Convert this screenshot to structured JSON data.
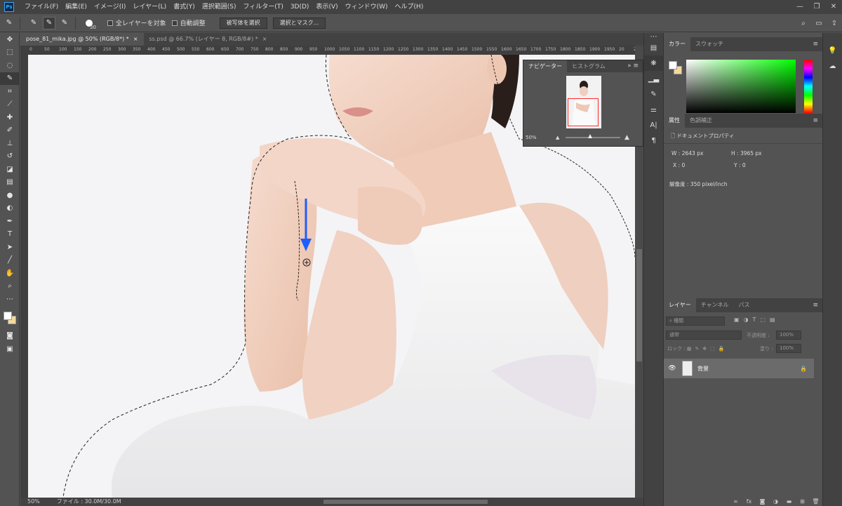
{
  "menubar": {
    "logo": "Ps",
    "items": [
      "ファイル(F)",
      "編集(E)",
      "イメージ(I)",
      "レイヤー(L)",
      "書式(Y)",
      "選択範囲(S)",
      "フィルター(T)",
      "3D(D)",
      "表示(V)",
      "ウィンドウ(W)",
      "ヘルプ(H)"
    ]
  },
  "options": {
    "brush_size": "30",
    "sample_all": "全レイヤーを対象",
    "auto_enhance": "自動調整",
    "select_subject": "被写体を選択",
    "select_mask": "選択とマスク..."
  },
  "tabs": [
    {
      "label": "pose_81_mika.jpg @ 50% (RGB/8*) *",
      "close": "×"
    },
    {
      "label": "ss.psd @ 66.7% (レイヤー 8, RGB/8#) *",
      "close": "×"
    }
  ],
  "ruler": {
    "top_ticks": [
      "0",
      "50",
      "100",
      "150",
      "200",
      "250",
      "300",
      "350",
      "400",
      "450",
      "500",
      "550",
      "600",
      "650",
      "700",
      "750",
      "800",
      "850",
      "900",
      "950",
      "1000",
      "1050",
      "1100",
      "1150",
      "1200",
      "1250",
      "1300",
      "1350",
      "1400",
      "1450",
      "1500",
      "1550",
      "1600",
      "1650",
      "1700",
      "1750",
      "1800",
      "1850",
      "1900",
      "1950",
      "20",
      "25"
    ]
  },
  "status": {
    "zoom": "50%",
    "file": "ファイル : 30.0M/30.0M"
  },
  "navigator": {
    "tabs": [
      "ナビゲーター",
      "ヒストグラム"
    ],
    "zoom": "50%"
  },
  "color_panel": {
    "tabs": [
      "カラー",
      "スウォッチ"
    ],
    "fg": "#ffffff",
    "bg": "#f5d99c"
  },
  "properties": {
    "tabs": [
      "属性",
      "色調補正"
    ],
    "section": "ドキュメントプロパティ",
    "w_label": "W :",
    "w_value": "2643 px",
    "h_label": "H :",
    "h_value": "3965 px",
    "x_label": "X :",
    "x_value": "0",
    "y_label": "Y :",
    "y_value": "0",
    "resolution": "解像度 : 350 pixel/inch"
  },
  "layers": {
    "tabs": [
      "レイヤー",
      "チャンネル",
      "パス"
    ],
    "filter_placeholder": "種類",
    "blend_mode": "通常",
    "opacity_label": "不透明度 :",
    "opacity_value": "100%",
    "lock_label": "ロック :",
    "fill_label": "塗り :",
    "fill_value": "100%",
    "layer_name": "背景"
  },
  "icons": {
    "accent": "#1e5eff"
  }
}
